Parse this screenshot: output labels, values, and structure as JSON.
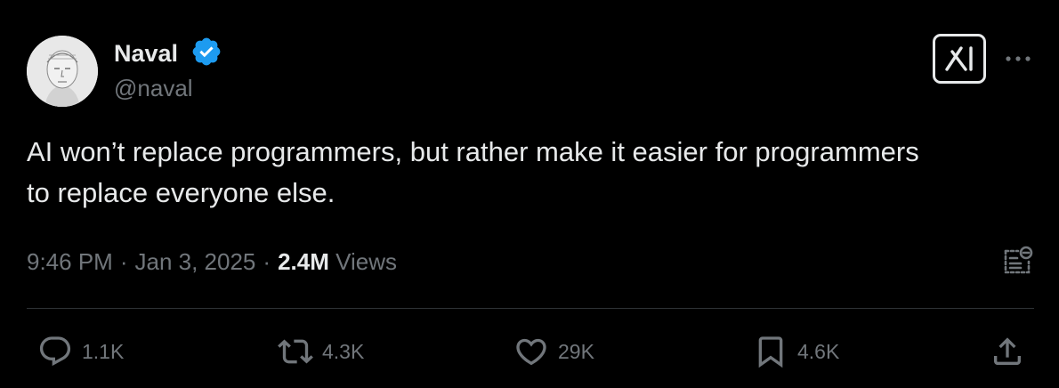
{
  "author": {
    "name": "Naval",
    "handle": "@naval"
  },
  "tweet": {
    "lines": [
      "AI won’t replace programmers, but rather make it easier for programmers",
      "to replace everyone else."
    ]
  },
  "meta": {
    "time": "9:46 PM",
    "separator": "·",
    "date": "Jan 3, 2025",
    "views_count": "2.4M",
    "views_label": "Views"
  },
  "actions": {
    "replies": "1.1K",
    "reposts": "4.3K",
    "likes": "29K",
    "bookmarks": "4.6K"
  },
  "icons": {
    "verified": "verified-badge-icon",
    "grok": "grok-icon",
    "more": "more-icon",
    "notes": "community-notes-icon",
    "reply": "reply-icon",
    "repost": "repost-icon",
    "like": "like-icon",
    "bookmark": "bookmark-icon",
    "share": "share-icon"
  },
  "colors": {
    "background": "#000000",
    "text": "#e7e9ea",
    "muted": "#71767b",
    "verified": "#1d9bf0",
    "divider": "#2f3336"
  }
}
